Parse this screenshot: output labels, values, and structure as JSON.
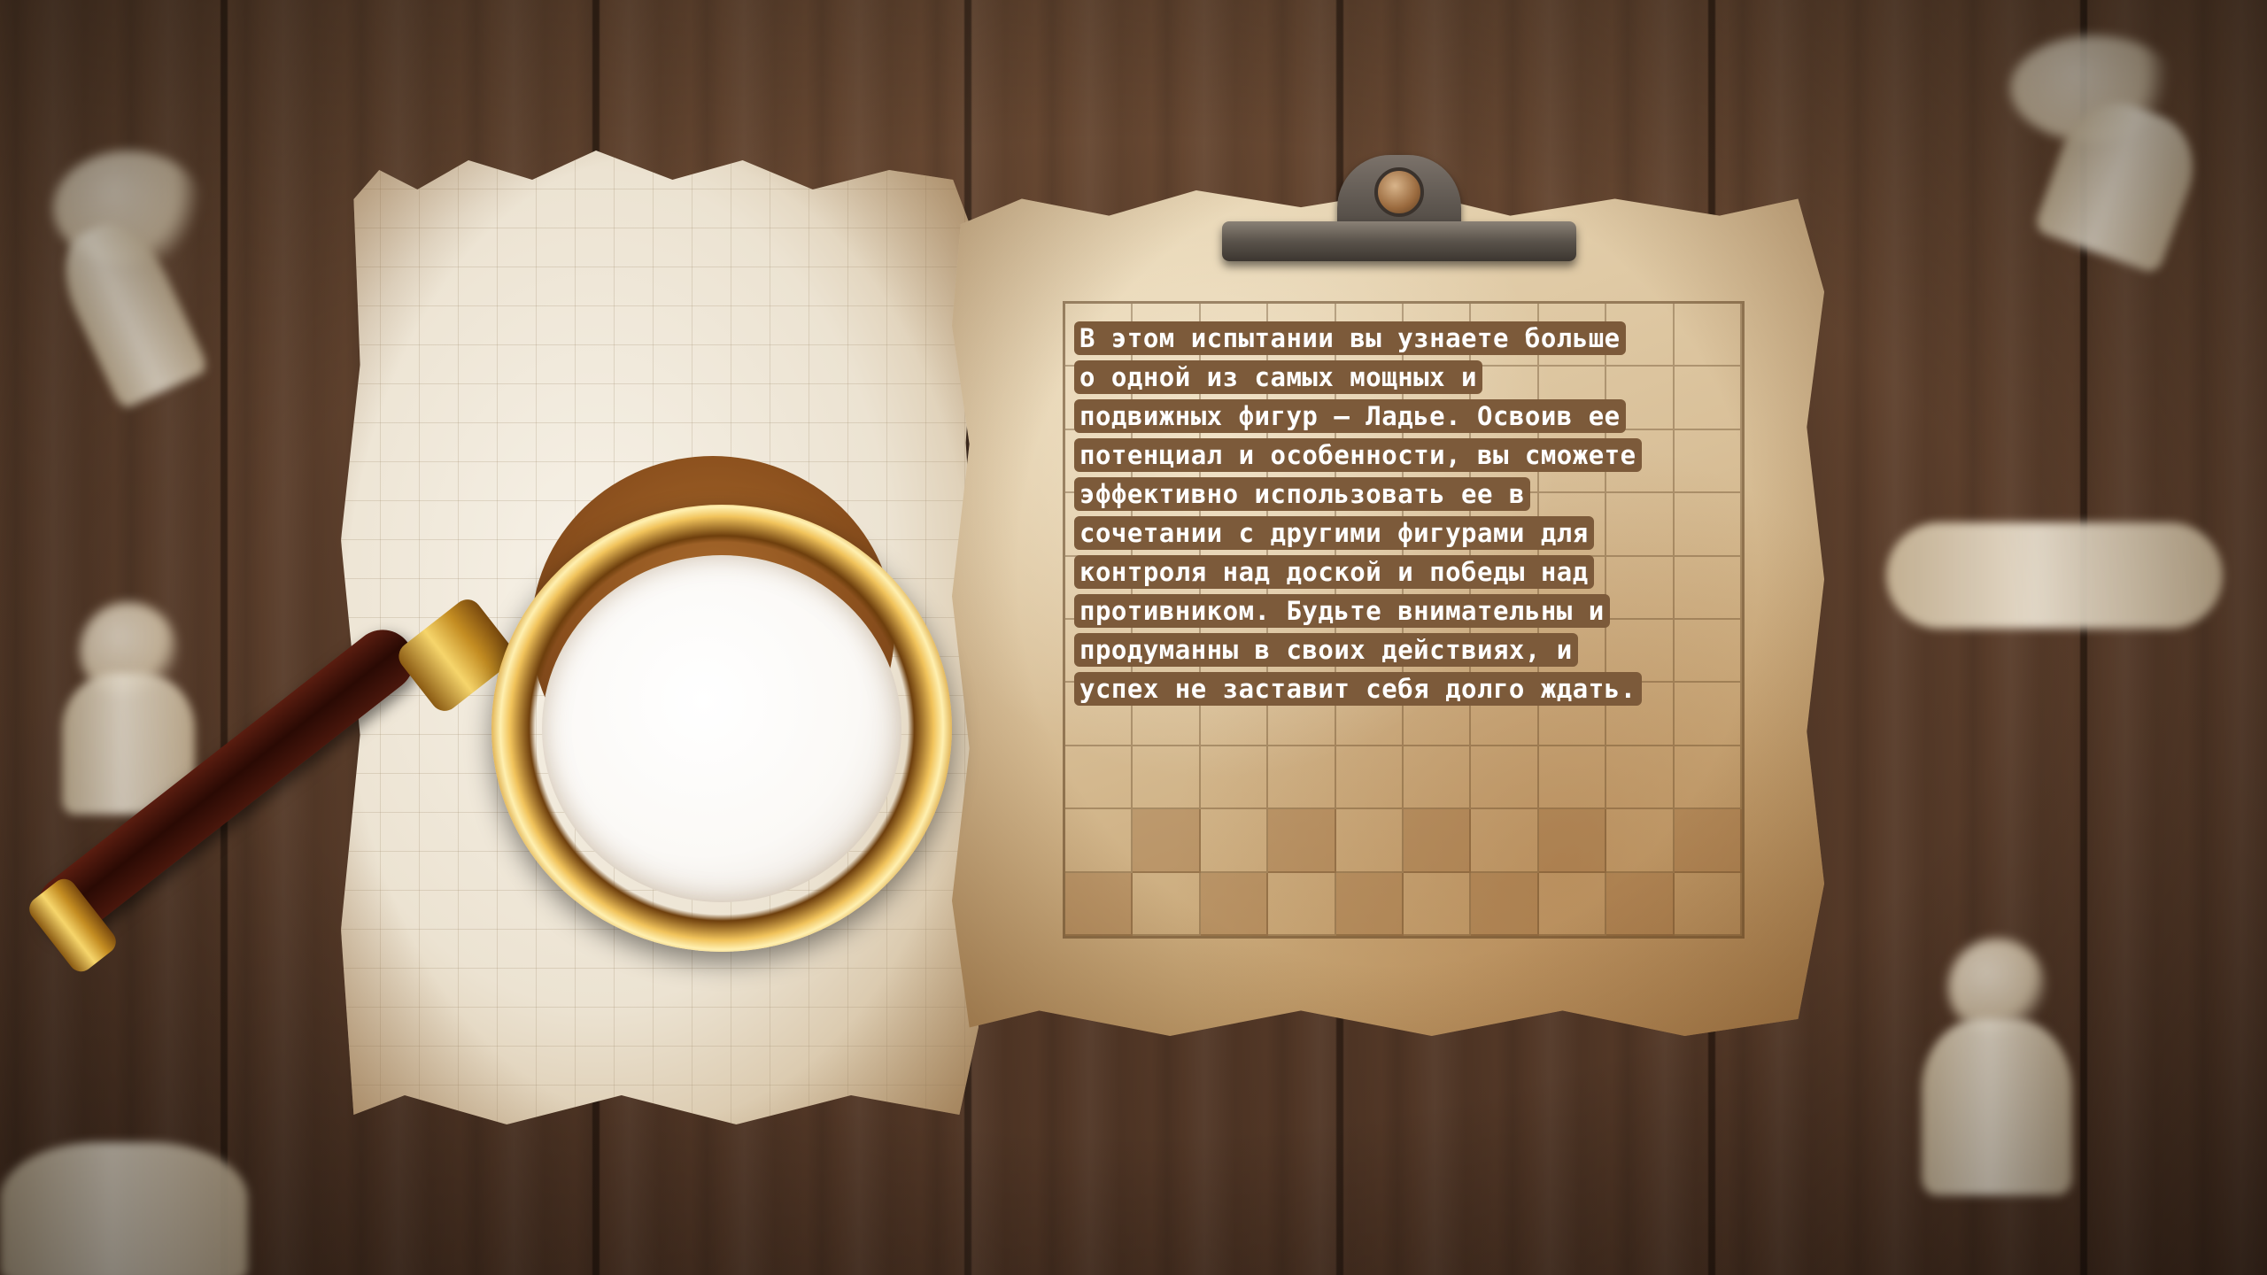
{
  "scene": {
    "theme_colors": {
      "wood": "#5b3e2b",
      "paper": "#ead9b8",
      "text_highlight": "#7c5a3a",
      "text": "#ffffff",
      "gold": "#f1c35b"
    }
  },
  "info_panel": {
    "lines": [
      "В этом испытании вы узнаете больше",
      "о одной из самых мощных и",
      "подвижных фигур – Ладье. Освоив ее",
      "потенциал и особенности, вы сможете",
      "эффективно использовать ее в",
      "сочетании с другими фигурами для",
      "контроля над доской и победы над",
      "противником. Будьте внимательны и",
      "продуманны в своих действиях, и",
      "успех не заставит себя долго ждать."
    ]
  },
  "icons": {
    "magnifier": "magnifying-glass-icon",
    "clip": "clipboard-clip-icon"
  }
}
